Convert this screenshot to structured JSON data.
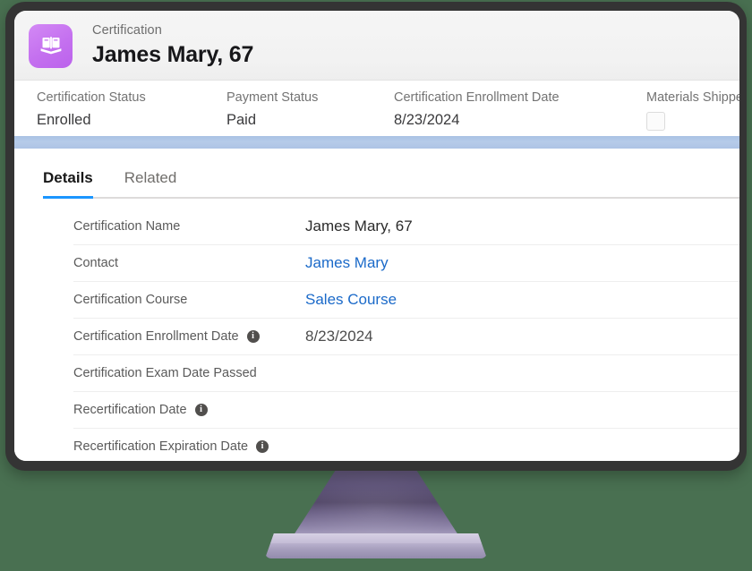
{
  "record": {
    "type_label": "Certification",
    "name": "James Mary, 67",
    "icon": "open-book-icon",
    "icon_color": "#c470ef"
  },
  "highlights": [
    {
      "label": "Certification Status",
      "value": "Enrolled",
      "kind": "text"
    },
    {
      "label": "Payment Status",
      "value": "Paid",
      "kind": "text"
    },
    {
      "label": "Certification Enrollment Date",
      "value": "8/23/2024",
      "kind": "text"
    },
    {
      "label": "Materials Shipped",
      "value": "",
      "kind": "checkbox",
      "checked": false
    }
  ],
  "tabs": [
    {
      "label": "Details",
      "active": true
    },
    {
      "label": "Related",
      "active": false
    }
  ],
  "details": [
    {
      "label": "Certification Name",
      "value": "James Mary, 67",
      "info": false,
      "link": false
    },
    {
      "label": "Contact",
      "value": "James Mary",
      "info": false,
      "link": true
    },
    {
      "label": "Certification Course",
      "value": "Sales Course",
      "info": false,
      "link": true
    },
    {
      "label": "Certification Enrollment Date",
      "value": "8/23/2024",
      "info": true,
      "link": false
    },
    {
      "label": "Certification Exam Date Passed",
      "value": "",
      "info": false,
      "link": false
    },
    {
      "label": "Recertification Date",
      "value": "",
      "info": true,
      "link": false
    },
    {
      "label": "Recertification Expiration Date",
      "value": "",
      "info": true,
      "link": false
    }
  ],
  "theme": {
    "background": "#497051",
    "bezel": "#343434",
    "accent_blue": "#1b96ff",
    "link_blue": "#1b6ac9",
    "band_blue": "#b6cbe9",
    "stand_purple": "#6b5f84"
  }
}
